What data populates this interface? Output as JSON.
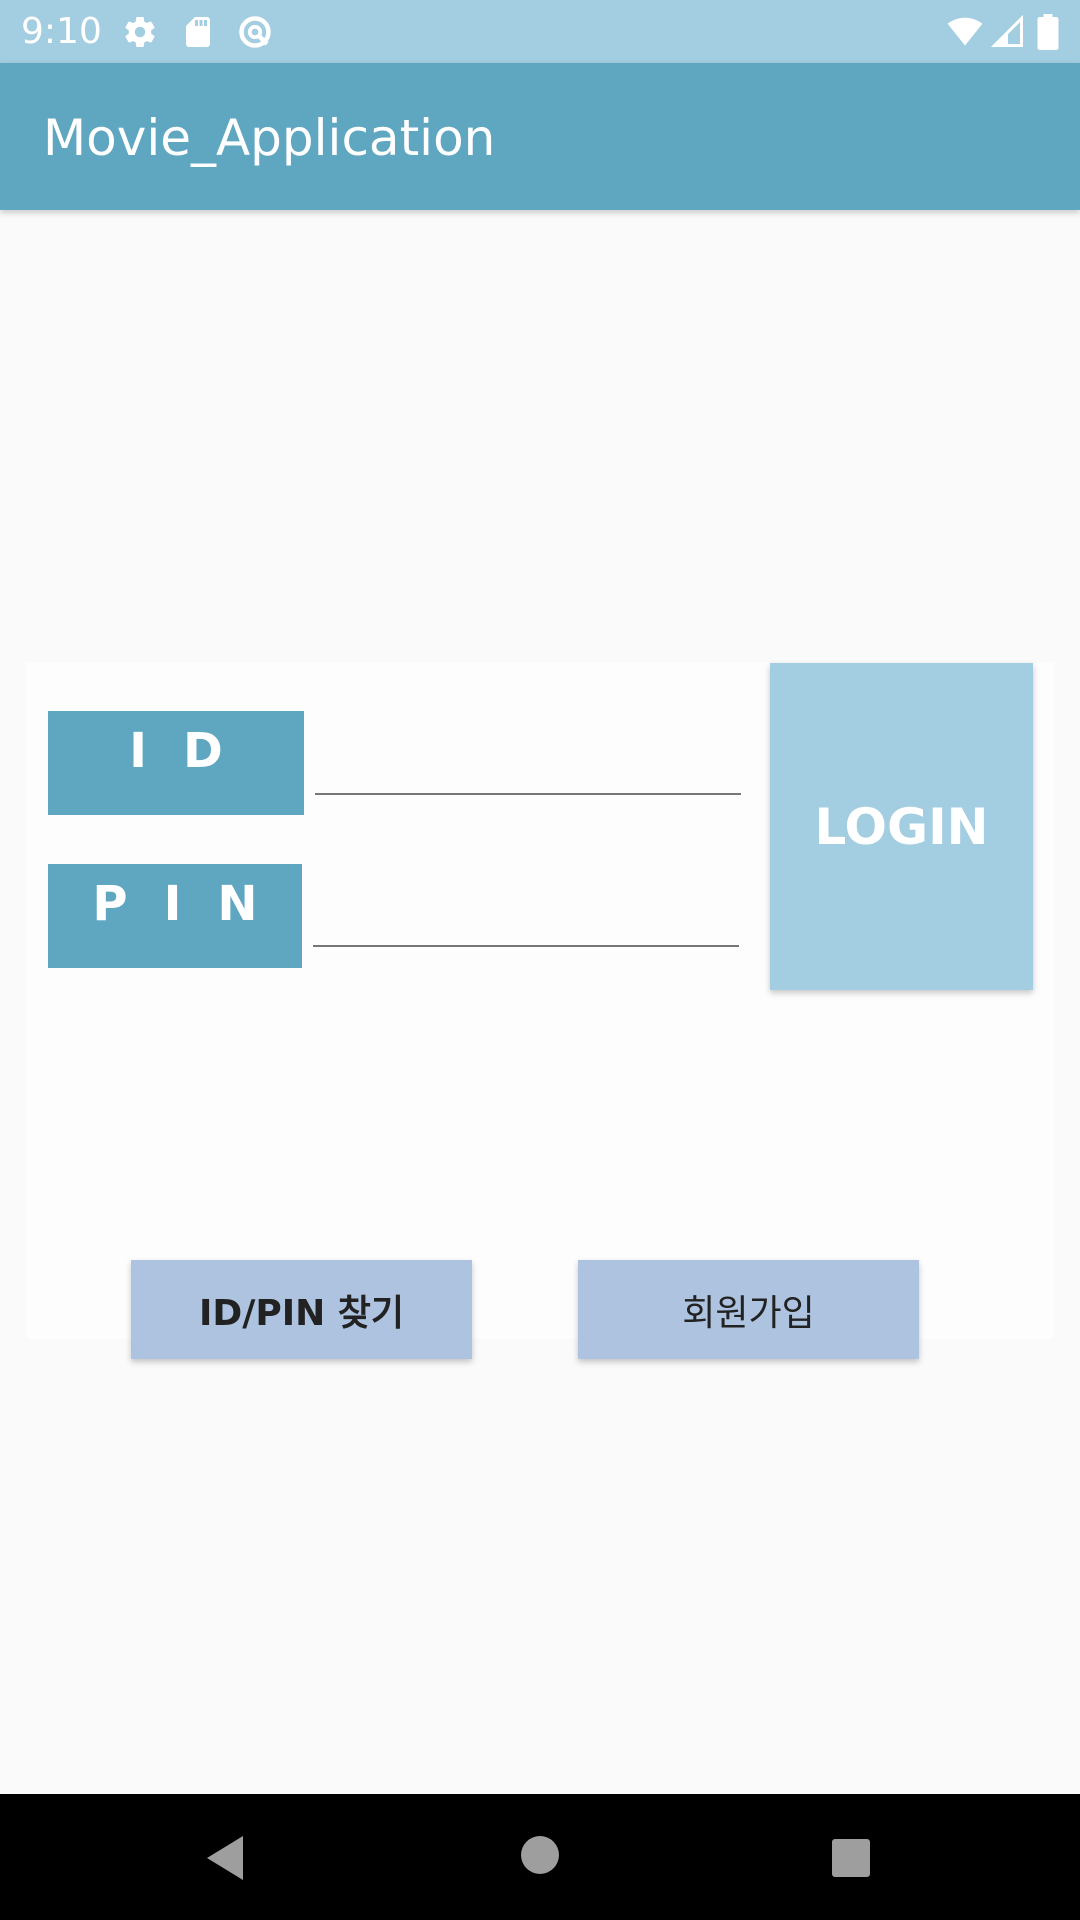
{
  "status_bar": {
    "time": "9:10",
    "left_icons": [
      "settings-icon",
      "sd-card-icon",
      "at-sign-icon"
    ],
    "right_icons": [
      "wifi-icon",
      "cellular-signal-icon",
      "battery-icon"
    ],
    "color": "#a3cde0"
  },
  "app_bar": {
    "title": "Movie_Application",
    "color": "#5fa6c1"
  },
  "login_form": {
    "id_label": "ID",
    "id_value": "",
    "pin_label": "PIN",
    "pin_value": "",
    "login_button": "LOGIN"
  },
  "actions": {
    "find_button": "ID/PIN 찾기",
    "signup_button": "회원가입"
  },
  "nav_bar": {
    "icons": [
      "back-icon",
      "home-icon",
      "recents-icon"
    ]
  },
  "colors": {
    "label_bg": "#5fa6c1",
    "login_bg": "#a3cde0",
    "action_bg": "#adc3df"
  }
}
